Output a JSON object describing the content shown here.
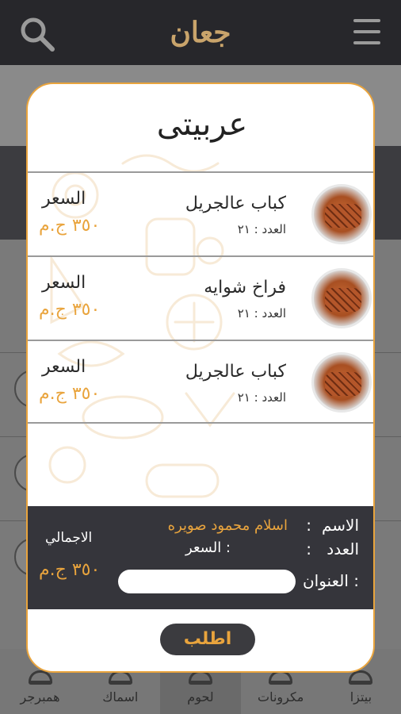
{
  "app": {
    "logo_text": "جعان"
  },
  "bottom_nav": [
    {
      "label": "بيتزا",
      "icon": "pizza-icon"
    },
    {
      "label": "مكرونات",
      "icon": "pasta-icon"
    },
    {
      "label": "لحوم",
      "icon": "meat-icon"
    },
    {
      "label": "اسماك",
      "icon": "fish-icon"
    },
    {
      "label": "همبرجر",
      "icon": "burger-icon"
    }
  ],
  "modal": {
    "title": "عربيتى",
    "items": [
      {
        "name": "كباب عالجريل",
        "qty": "العدد : ٢١",
        "price_label": "السعر",
        "price": "٣٥٠ ج.م"
      },
      {
        "name": "فراخ شوايه",
        "qty": "العدد : ٢١",
        "price_label": "السعر",
        "price": "٣٥٠ ج.م"
      },
      {
        "name": "كباب عالجريل",
        "qty": "العدد : ٢١",
        "price_label": "السعر",
        "price": "٣٥٠ ج.م"
      }
    ],
    "summary": {
      "name_label": "الاسم",
      "name_sep": ":",
      "name_value": "اسلام محمود صويره",
      "count_label": "العدد",
      "count_sep": ":",
      "price_label": "السعر :",
      "address_label": "العنوان :",
      "address_placeholder": "",
      "total_label": "الاجمالي",
      "total_value": "٣٥٠ ج.م"
    },
    "order_button": "اطلب"
  },
  "colors": {
    "accent": "#e9a43d",
    "dark": "#35353b",
    "appbar": "#27272b"
  }
}
